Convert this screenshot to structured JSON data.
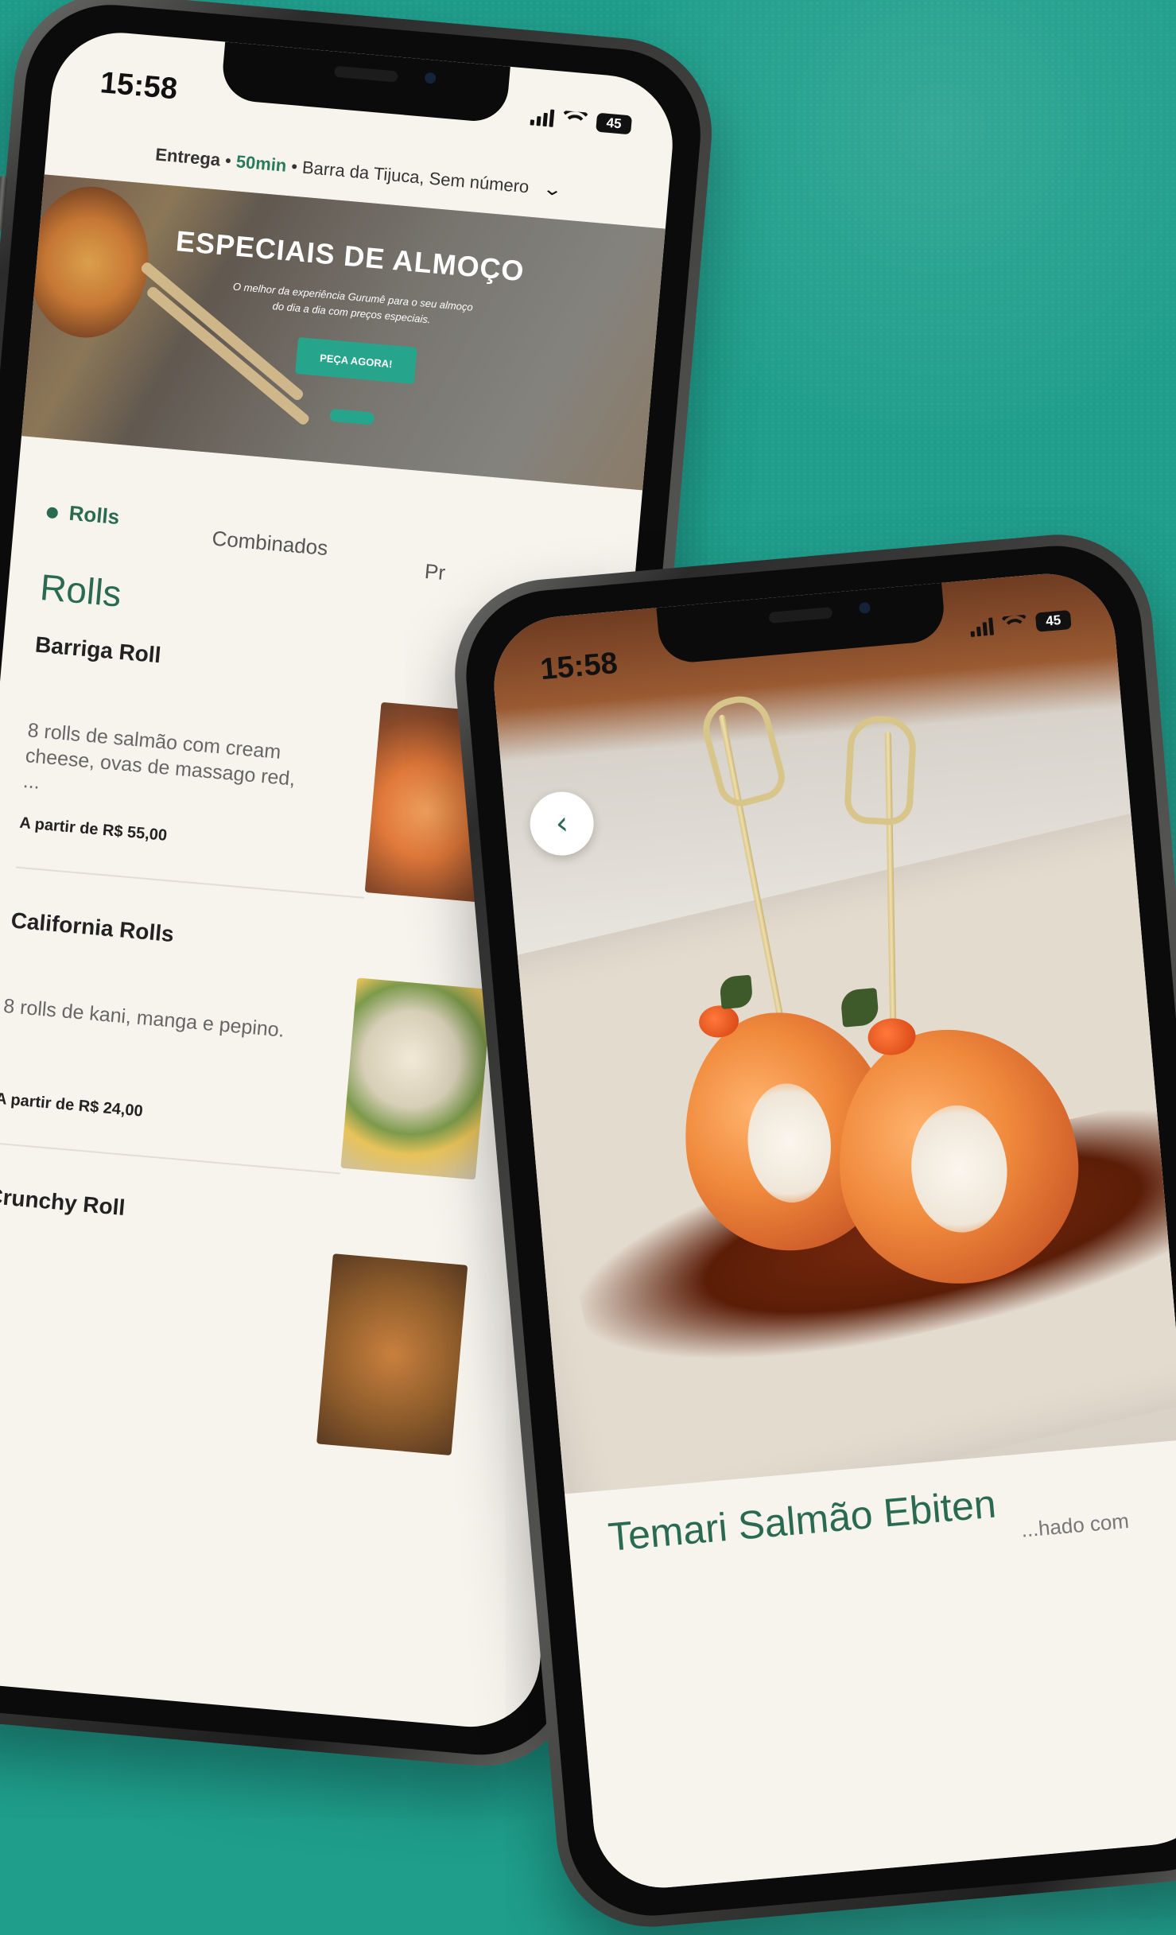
{
  "colors": {
    "background": "#1f9e8c",
    "brand_green": "#2a6a50",
    "accent_teal": "#27a58c",
    "screen_bg": "#f7f4ee"
  },
  "left_phone": {
    "status": {
      "time": "15:58",
      "battery": "45"
    },
    "delivery": {
      "mode": "Entrega",
      "time": "50min",
      "address": "Barra da Tijuca, Sem número",
      "chevron_icon": "chevron-down-icon"
    },
    "banner": {
      "title": "ESPECIAIS DE ALMOÇO",
      "subtitle": "O melhor da experiência Gurumê para o seu almoço do dia a dia com preços especiais.",
      "cta_label": "PEÇA AGORA!"
    },
    "category_tabs": [
      {
        "label": "Rolls",
        "active": true
      },
      {
        "label": "Combinados",
        "active": false
      },
      {
        "label": "Pr",
        "active": false
      }
    ],
    "section_title": "Rolls",
    "menu_items": [
      {
        "name": "Barriga Roll",
        "description": "8 rolls de salmão com cream cheese, ovas de massago red, ...",
        "price": "A partir de R$ 55,00"
      },
      {
        "name": "California Rolls",
        "description": "8 rolls de kani, manga e pepino.",
        "price": "A partir de R$ 24,00"
      },
      {
        "name": "Crunchy Roll",
        "description": "",
        "price": ""
      }
    ]
  },
  "right_phone": {
    "status": {
      "time": "15:58",
      "battery": "45"
    },
    "back_icon": "chevron-left-icon",
    "product": {
      "title": "Temari Salmão Ebiten",
      "description_peek": "...hado com"
    }
  }
}
